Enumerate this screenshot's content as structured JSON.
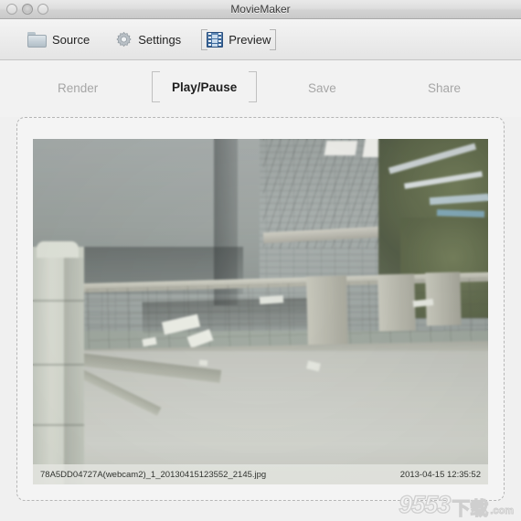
{
  "window": {
    "title": "MovieMaker",
    "controls": [
      {
        "name": "close-button",
        "label": "close"
      },
      {
        "name": "minimize-button",
        "label": "minimize"
      },
      {
        "name": "zoom-button",
        "label": "zoom"
      }
    ]
  },
  "toolbar": {
    "items": [
      {
        "label": "Source",
        "icon": "folder-icon",
        "selected": false
      },
      {
        "label": "Settings",
        "icon": "gear-icon",
        "selected": false
      },
      {
        "label": "Preview",
        "icon": "film-strip-icon",
        "selected": true
      }
    ]
  },
  "actions": {
    "render": {
      "label": "Render",
      "state": "disabled"
    },
    "play_pause": {
      "label": "Play/Pause",
      "state": "active"
    },
    "save": {
      "label": "Save",
      "state": "disabled"
    },
    "share": {
      "label": "Share",
      "state": "disabled"
    }
  },
  "preview": {
    "filename": "78A5DD04727A(webcam2)_1_20130415123552_2145.jpg",
    "timestamp": "2013-04-15 12:35:52"
  },
  "watermark": {
    "number": "9553",
    "cn": "下载",
    "domain": ".com"
  },
  "colors": {
    "titlebar": "#dedede",
    "toolbar": "#ececec",
    "body": "#f2f2f2",
    "active_text": "#1f1f1f",
    "disabled_text": "#a6a6a6",
    "dashed_border": "#b6b6b6",
    "film_icon": "#2f5d93"
  }
}
